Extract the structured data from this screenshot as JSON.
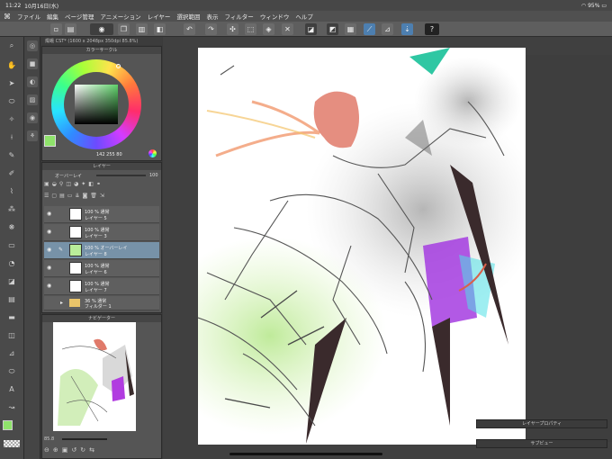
{
  "status": {
    "time": "11:22",
    "date": "10月16日(水)",
    "battery": "95%"
  },
  "menu": [
    "ファイル",
    "編集",
    "ページ管理",
    "アニメーション",
    "レイヤー",
    "選択範囲",
    "表示",
    "フィルター",
    "ウィンドウ",
    "ヘルプ"
  ],
  "document_tab": "燭蛾 CST* (1600 x 2048px 350dpi 85.8%)",
  "color_panel": {
    "title": "カラーサークル",
    "values": "142  255  80",
    "main_color": "#8fe36b"
  },
  "layer_panel": {
    "title": "レイヤー",
    "blend_mode": "オーバーレイ",
    "opacity": "100",
    "layers": [
      {
        "mode": "100 % 通常",
        "name": "レイヤー 5"
      },
      {
        "mode": "100 % 通常",
        "name": "レイヤー 3"
      },
      {
        "mode": "100 % オーバーレイ",
        "name": "レイヤー 8"
      },
      {
        "mode": "100 % 通常",
        "name": "レイヤー 6"
      },
      {
        "mode": "100 % 通常",
        "name": "レイヤー 7"
      },
      {
        "mode": "36 % 通常",
        "name": "フィルダー 1"
      }
    ]
  },
  "nav_panel": {
    "title": "ナビゲーター",
    "zoom": "85.8"
  },
  "mini_panels": {
    "layer_property": "レイヤープロパティ",
    "sub_view": "サブビュー"
  }
}
